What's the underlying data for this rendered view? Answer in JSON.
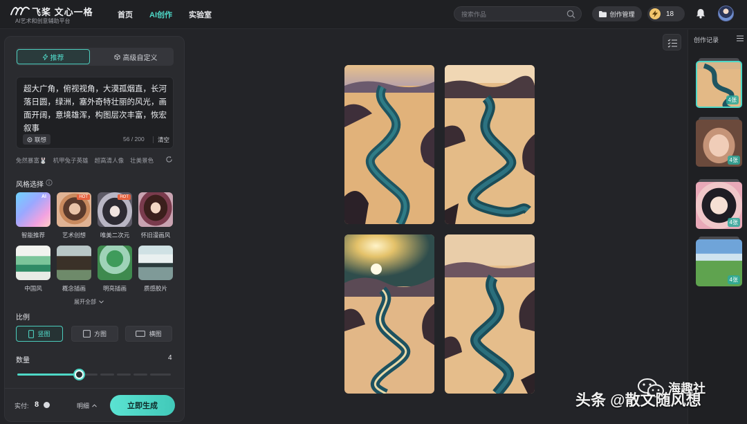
{
  "header": {
    "logo_title": "飞桨 文心一格",
    "logo_sub": "AI艺术和创意辅助平台",
    "nav": [
      {
        "label": "首页",
        "active": false
      },
      {
        "label": "AI创作",
        "active": true
      },
      {
        "label": "实验室",
        "active": false
      }
    ],
    "search_placeholder": "搜索作品",
    "manage_label": "创作管理",
    "credits": "18"
  },
  "panel": {
    "tabs": [
      {
        "label": "推荐",
        "active": true
      },
      {
        "label": "高级自定义",
        "active": false
      }
    ],
    "prompt": "超大广角，俯视视角，大漠孤烟直，长河落日圆，绿洲，塞外奇特壮丽的风光，画面开阔，意境雄浑，构图层次丰富，恢宏叙事",
    "assoc_label": "联想",
    "char_count": "56 / 200",
    "clear_label": "清空",
    "suggestions": [
      "免然暴富🐰",
      "机甲兔子英雄",
      "超高清人像",
      "壮美景色"
    ],
    "style_label": "风格选择",
    "styles": [
      {
        "name": "智能推荐",
        "badge": "AI"
      },
      {
        "name": "艺术创想",
        "badge": "HOT"
      },
      {
        "name": "唯美二次元",
        "badge": "HOT"
      },
      {
        "name": "怀旧漫画风",
        "badge": ""
      },
      {
        "name": "中国风",
        "badge": ""
      },
      {
        "name": "概念插画",
        "badge": ""
      },
      {
        "name": "明亮插画",
        "badge": ""
      },
      {
        "name": "质感胶片",
        "badge": ""
      }
    ],
    "expand_label": "展开全部",
    "ratio_label": "比例",
    "ratios": [
      {
        "label": "竖图",
        "active": true
      },
      {
        "label": "方图",
        "active": false
      },
      {
        "label": "横图",
        "active": false
      }
    ],
    "count_label": "数量",
    "count_value": "4",
    "count_fraction": 0.4,
    "pay_label": "实付:",
    "pay_value": "8",
    "detail_label": "明细",
    "generate_label": "立即生成"
  },
  "history": {
    "title": "创作记录",
    "items": [
      {
        "count": "4张",
        "selected": true
      },
      {
        "count": "4张",
        "selected": false
      },
      {
        "count": "4张",
        "selected": false
      },
      {
        "count": "4张",
        "selected": false
      }
    ]
  },
  "watermark": {
    "left": "头条 @散文随风想",
    "right": "海趣社"
  },
  "colors": {
    "accent": "#4ed9c8",
    "background": "#232428",
    "panel": "#2a2b2f"
  }
}
